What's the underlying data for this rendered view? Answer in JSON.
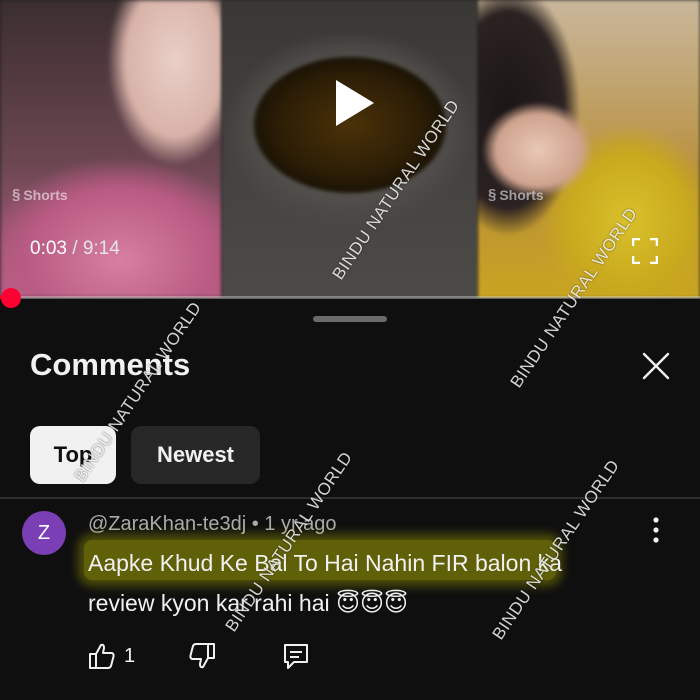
{
  "video": {
    "shorts_badge_left": "Shorts",
    "shorts_badge_right": "Shorts",
    "current_time": "0:03",
    "separator": " / ",
    "duration": "9:14",
    "progress_fraction": 0.005,
    "accent_color": "#ff0000"
  },
  "sheet": {
    "title": "Comments",
    "chips": [
      {
        "label": "Top",
        "selected": true
      },
      {
        "label": "Newest",
        "selected": false
      }
    ]
  },
  "comment": {
    "avatar_letter": "Z",
    "avatar_color": "#7b3fb5",
    "meta": "@ZaraKhan-te3dj • 1 yr ago",
    "text_line1": "Aapke Khud Ke Bal To Hai Nahin FIR balon ka",
    "text_line2": "review kyon kar rahi hai 😇😇😇",
    "like_count": "1"
  },
  "watermark": {
    "text": "BINDU NATURAL WORLD"
  },
  "icons": [
    "play-icon",
    "fullscreen-icon",
    "close-icon",
    "more-vertical-icon",
    "thumbs-up-icon",
    "thumbs-down-icon",
    "reply-icon"
  ]
}
